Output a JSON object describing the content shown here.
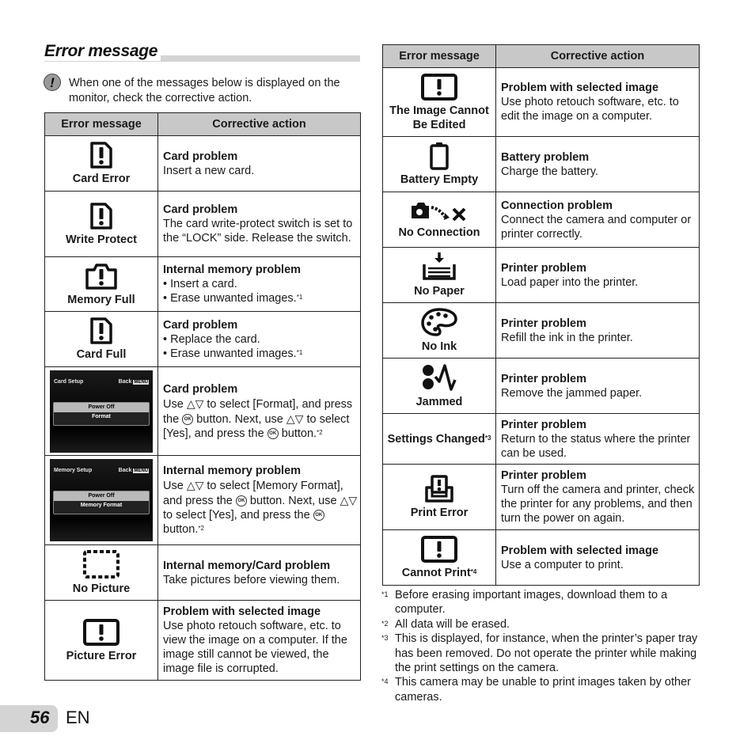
{
  "section_title": "Error message",
  "note": {
    "icon": "caution-icon",
    "text": "When one of the messages below is displayed on the monitor, check the corrective action."
  },
  "table_headers": {
    "message": "Error message",
    "action": "Corrective action"
  },
  "left_table": [
    {
      "icon": "card-error-icon",
      "message": "Card Error",
      "heading": "Card problem",
      "lines": [
        "Insert a new card."
      ]
    },
    {
      "icon": "card-error-icon",
      "message": "Write Protect",
      "heading": "Card problem",
      "lines": [
        "The card write-protect switch is set to the “LOCK” side. Release the switch."
      ]
    },
    {
      "icon": "memory-full-icon",
      "message": "Memory Full",
      "heading": "Internal memory problem",
      "lines": [
        "• Insert a card.",
        "• Erase unwanted images."
      ],
      "footnote_ref": "*1"
    },
    {
      "icon": "card-error-icon",
      "message": "Card Full",
      "heading": "Card problem",
      "lines": [
        "• Replace the card.",
        "• Erase unwanted images."
      ],
      "footnote_ref": "*1"
    },
    {
      "screen": {
        "title": "Card Setup",
        "back": "Back",
        "menu": "MENU",
        "options": [
          "Power Off",
          "Format"
        ]
      },
      "heading": "Card problem",
      "text_parts": [
        "Use ",
        " to select [Format], and press the ",
        " button. Next, use ",
        " to select [Yes], and press the ",
        " button."
      ],
      "footnote_ref": "*2"
    },
    {
      "screen": {
        "title": "Memory Setup",
        "back": "Back",
        "menu": "MENU",
        "options": [
          "Power Off",
          "Memory Format"
        ]
      },
      "heading": "Internal memory problem",
      "text_parts": [
        "Use ",
        " to select [Memory Format], and press the ",
        " button. Next, use ",
        " to select [Yes], and press the ",
        " button."
      ],
      "footnote_ref": "*2"
    },
    {
      "icon": "no-picture-icon",
      "message": "No Picture",
      "heading": "Internal memory/Card problem",
      "lines": [
        "Take pictures before viewing them."
      ]
    },
    {
      "icon": "picture-error-icon",
      "message": "Picture Error",
      "heading": "Problem with selected image",
      "lines": [
        "Use photo retouch software, etc. to view the image on a computer. If the image still cannot be viewed, the image file is corrupted."
      ]
    }
  ],
  "right_table": [
    {
      "icon": "picture-error-icon",
      "message": "The Image Cannot Be Edited",
      "heading": "Problem with selected image",
      "lines": [
        "Use photo retouch software, etc. to edit the image on a computer."
      ]
    },
    {
      "icon": "battery-empty-icon",
      "message": "Battery Empty",
      "heading": "Battery problem",
      "lines": [
        "Charge the battery."
      ]
    },
    {
      "icon": "no-connection-icon",
      "message": "No Connection",
      "heading": "Connection problem",
      "lines": [
        "Connect the camera and computer or printer correctly."
      ]
    },
    {
      "icon": "no-paper-icon",
      "message": "No Paper",
      "heading": "Printer problem",
      "lines": [
        "Load paper into the printer."
      ]
    },
    {
      "icon": "no-ink-icon",
      "message": "No Ink",
      "heading": "Printer problem",
      "lines": [
        "Refill the ink in the printer."
      ]
    },
    {
      "icon": "jammed-icon",
      "message": "Jammed",
      "heading": "Printer problem",
      "lines": [
        "Remove the jammed paper."
      ]
    },
    {
      "message": "Settings Changed",
      "message_ref": "*3",
      "heading": "Printer problem",
      "lines": [
        "Return to the status where the printer can be used."
      ]
    },
    {
      "icon": "print-error-icon",
      "message": "Print Error",
      "heading": "Printer problem",
      "lines": [
        "Turn off the camera and printer, check the printer for any problems, and then turn the power on again."
      ]
    },
    {
      "icon": "picture-error-icon",
      "message": "Cannot Print",
      "message_ref": "*4",
      "heading": "Problem with selected image",
      "lines": [
        "Use a computer to print."
      ]
    }
  ],
  "footnotes": [
    {
      "mark": "*1",
      "text": "Before erasing important images, download them to a computer."
    },
    {
      "mark": "*2",
      "text": "All data will be erased."
    },
    {
      "mark": "*3",
      "text": "This is displayed, for instance, when the printer’s paper tray has been removed. Do not operate the printer while making the print settings on the camera."
    },
    {
      "mark": "*4",
      "text": "This camera may be unable to print images taken by other cameras."
    }
  ],
  "page": {
    "number": "56",
    "language": "EN"
  }
}
